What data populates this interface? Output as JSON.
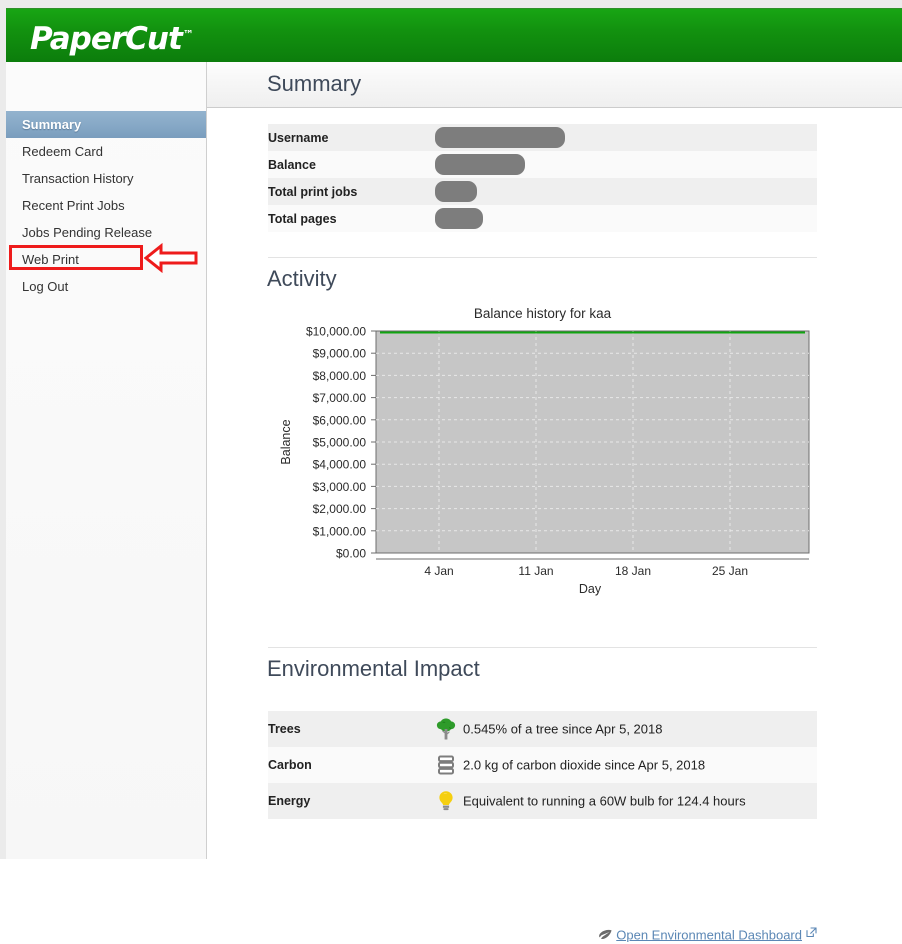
{
  "brand": {
    "name": "PaperCut",
    "trademark": "™"
  },
  "header": {
    "title": "Summary"
  },
  "sidebar": {
    "items": [
      {
        "label": "Summary",
        "selected": true
      },
      {
        "label": "Redeem Card",
        "selected": false
      },
      {
        "label": "Transaction History",
        "selected": false
      },
      {
        "label": "Recent Print Jobs",
        "selected": false
      },
      {
        "label": "Jobs Pending Release",
        "selected": false
      },
      {
        "label": "Web Print",
        "selected": false
      },
      {
        "label": "Log Out",
        "selected": false
      }
    ],
    "annotation": {
      "target_label": "Web Print",
      "box_color": "#ee1b1b",
      "arrow_color": "#ee1b1b"
    }
  },
  "summary_table": {
    "rows": [
      {
        "label": "Username",
        "value": "",
        "redacted": true,
        "redacted_width": 130
      },
      {
        "label": "Balance",
        "value": "",
        "redacted": true,
        "redacted_width": 90
      },
      {
        "label": "Total print jobs",
        "value": "",
        "redacted": true,
        "redacted_width": 42
      },
      {
        "label": "Total pages",
        "value": "",
        "redacted": true,
        "redacted_width": 48
      }
    ]
  },
  "activity": {
    "heading": "Activity"
  },
  "chart_data": {
    "type": "line",
    "title": "Balance history for kaa",
    "xlabel": "Day",
    "ylabel": "Balance",
    "x_tick_labels": [
      "4 Jan",
      "11 Jan",
      "18 Jan",
      "25 Jan"
    ],
    "x_tick_positions": [
      0.145,
      0.37,
      0.595,
      0.82
    ],
    "y_tick_labels": [
      "$10,000.00",
      "$9,000.00",
      "$8,000.00",
      "$7,000.00",
      "$6,000.00",
      "$5,000.00",
      "$4,000.00",
      "$3,000.00",
      "$2,000.00",
      "$1,000.00",
      "$0.00"
    ],
    "ylim": [
      0,
      10000
    ],
    "grid": true,
    "legend": "none",
    "plot_background": "#c6c6c6",
    "gridline_color": "#e8e8e8",
    "series": [
      {
        "name": "Balance",
        "color": "#10a510",
        "x": [
          0,
          1
        ],
        "values": [
          10000,
          10000
        ]
      }
    ]
  },
  "environmental": {
    "heading": "Environmental Impact",
    "rows": [
      {
        "label": "Trees",
        "icon": "tree-icon",
        "text": "0.545% of a tree since Apr 5, 2018"
      },
      {
        "label": "Carbon",
        "icon": "carbon-icon",
        "text": "2.0 kg of carbon dioxide since Apr 5, 2018"
      },
      {
        "label": "Energy",
        "icon": "lightbulb-icon",
        "text": "Equivalent to running a 60W bulb for 124.4 hours"
      }
    ],
    "dashboard_link": {
      "label": "Open Environmental Dashboard",
      "leaf_icon": "leaf-icon",
      "external_icon": "external-link-icon"
    }
  },
  "colors": {
    "brand_green": "#12910f",
    "selected_nav": "#86a8c6",
    "link": "#5b87b5",
    "heading": "#3f4a5a",
    "annotation_red": "#ee1b1b"
  }
}
